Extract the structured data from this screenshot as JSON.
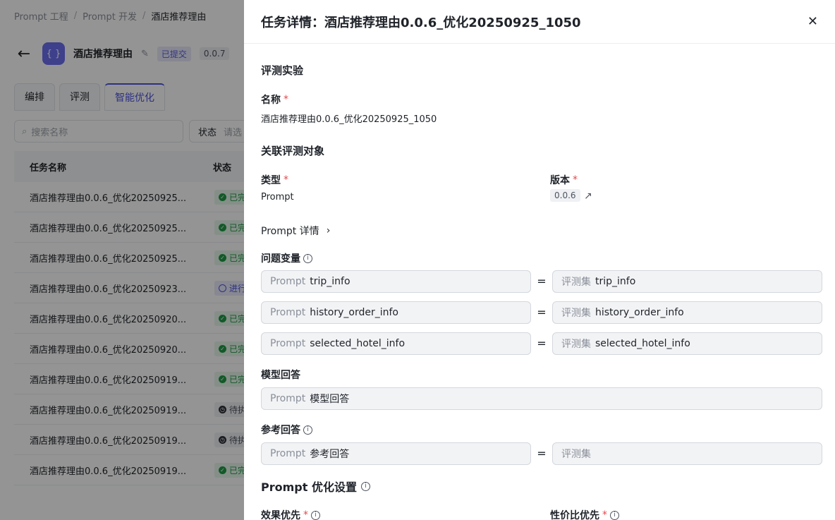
{
  "breadcrumb": [
    "Prompt 工程",
    "Prompt 开发",
    "酒店推荐理由"
  ],
  "breadcrumb_sep": "/",
  "header": {
    "app_icon": "{ }",
    "title": "酒店推荐理由",
    "status_tag": "已提交",
    "version_tag": "0.0.7"
  },
  "tabs": [
    "编排",
    "评测",
    "智能优化"
  ],
  "search": {
    "placeholder": "搜索名称"
  },
  "status_filter": {
    "label": "状态",
    "placeholder": "请选"
  },
  "table": {
    "columns": [
      "任务名称",
      "状态"
    ],
    "rows": [
      {
        "name": "酒店推荐理由0.0.6_优化20250925...",
        "status": "已完",
        "kind": "done"
      },
      {
        "name": "酒店推荐理由0.0.6_优化20250925...",
        "status": "已完",
        "kind": "done"
      },
      {
        "name": "酒店推荐理由0.0.6_优化20250925...",
        "status": "已完",
        "kind": "done"
      },
      {
        "name": "酒店推荐理由0.0.6_优化20250923...",
        "status": "进行",
        "kind": "run"
      },
      {
        "name": "酒店推荐理由0.0.6_优化20250920...",
        "status": "已完",
        "kind": "done"
      },
      {
        "name": "酒店推荐理由0.0.6_优化20250920...",
        "status": "已完",
        "kind": "done"
      },
      {
        "name": "酒店推荐理由0.0.6_优化20250919...",
        "status": "已完",
        "kind": "done"
      },
      {
        "name": "酒店推荐理由0.0.6_优化20250919...",
        "status": "待执",
        "kind": "wait"
      },
      {
        "name": "酒店推荐理由0.0.6_优化20250919...",
        "status": "待执",
        "kind": "wait"
      },
      {
        "name": "酒店推荐理由0.0.6_优化20250919...",
        "status": "已完",
        "kind": "done"
      }
    ]
  },
  "drawer": {
    "title": "任务详情：酒店推荐理由0.0.6_优化20250925_1050",
    "section_experiment": "评测实验",
    "name_label": "名称",
    "name_value": "酒店推荐理由0.0.6_优化20250925_1050",
    "section_object": "关联评测对象",
    "type_label": "类型",
    "type_value": "Prompt",
    "version_label": "版本",
    "version_value": "0.0.6",
    "prompt_detail": "Prompt 详情",
    "vars_label": "问题变量",
    "prefix_prompt": "Prompt",
    "prefix_eval": "评测集",
    "var_rows": [
      {
        "left": "trip_info",
        "right": "trip_info"
      },
      {
        "left": "history_order_info",
        "right": "history_order_info"
      },
      {
        "left": "selected_hotel_info",
        "right": "selected_hotel_info"
      }
    ],
    "model_answer_label": "模型回答",
    "model_answer_value": "模型回答",
    "ref_answer_label": "参考回答",
    "ref_answer_value": "参考回答",
    "ref_answer_right": "",
    "section_optimize": "Prompt 优化设置",
    "effect_label": "效果优先",
    "cost_label": "性价比优先",
    "required_mark": "*",
    "equals": "="
  }
}
